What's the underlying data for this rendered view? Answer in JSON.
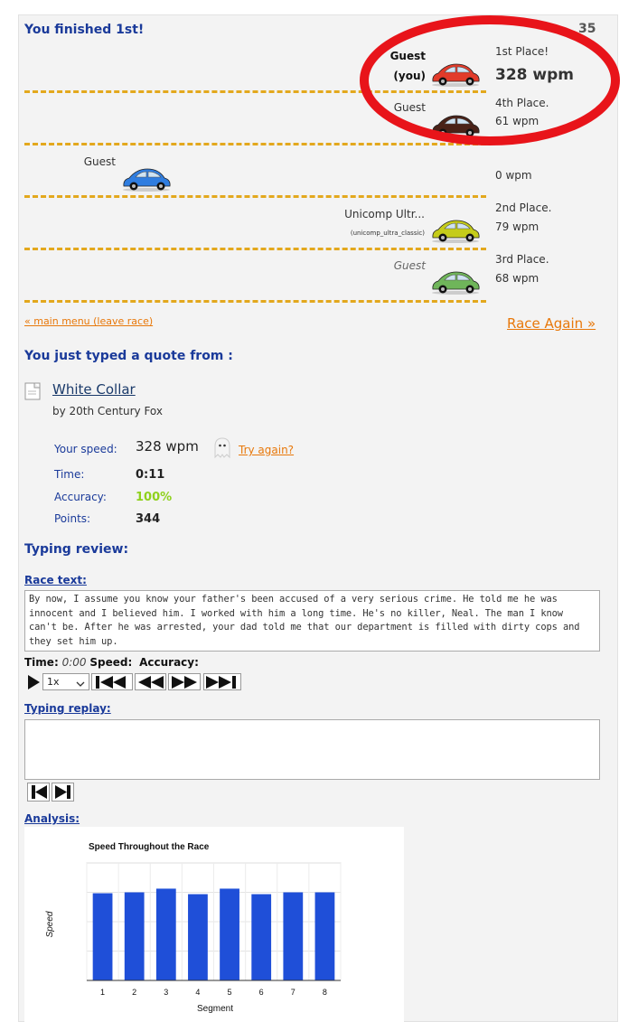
{
  "header": {
    "title": "You finished 1st!",
    "corner_num": "35"
  },
  "racers": [
    {
      "name": "Guest",
      "name2": "(you)",
      "place": "1st Place!",
      "wpm": "328 wpm",
      "car_color": "#e23b2a"
    },
    {
      "name": "Guest",
      "place": "4th Place.",
      "wpm": "61 wpm",
      "car_color": "#4a2218"
    },
    {
      "name": "Guest",
      "place": "",
      "wpm": "0 wpm",
      "car_color": "#2f7de0"
    },
    {
      "name": "Unicomp Ultr...",
      "sub": "(unicomp_ultra_classic)",
      "place": "2nd Place.",
      "wpm": "79 wpm",
      "car_color": "#c5cc19"
    },
    {
      "name": "Guest",
      "place": "3rd Place.",
      "wpm": "68 wpm",
      "car_color": "#6fb55a"
    }
  ],
  "links": {
    "main_menu": "« main menu (leave race)",
    "race_again": "Race Again »",
    "try_again": "Try again?"
  },
  "quote": {
    "heading": "You just typed a quote from :",
    "title": "White Collar",
    "by": "by 20th Century Fox",
    "icon": "document-icon"
  },
  "stats": {
    "speed_label": "Your speed:",
    "speed": "328 wpm",
    "time_label": "Time:",
    "time": "0:11",
    "accuracy_label": "Accuracy:",
    "accuracy": "100%",
    "points_label": "Points:",
    "points": "344",
    "accuracy_color": "#8fd11d"
  },
  "review": {
    "heading": "Typing review:",
    "race_text_label": "Race text:",
    "race_text": "By now, I assume you know your father's been accused of a very serious crime. He told me he was innocent and I believed him. I worked with him a long time. He's no killer, Neal. The man I know can't be. After he was arrested, your dad told me that our department is filled with dirty cops and they set him up.",
    "time_label": "Time:",
    "time_value": "0:00",
    "speed_label": "Speed:",
    "accuracy_label": "Accuracy:",
    "speed_select": "1x",
    "replay_label": "Typing replay:",
    "analysis_label": "Analysis:"
  },
  "chart_data": {
    "type": "bar",
    "title": "Speed Throughout the Race",
    "xlabel": "Segment",
    "ylabel": "Speed",
    "categories": [
      "1",
      "2",
      "3",
      "4",
      "5",
      "6",
      "7",
      "8"
    ],
    "values": [
      95,
      96,
      100,
      94,
      100,
      94,
      96,
      96
    ],
    "ylim": [
      0,
      128
    ],
    "grid": true,
    "bar_color": "#1f4fd8"
  }
}
